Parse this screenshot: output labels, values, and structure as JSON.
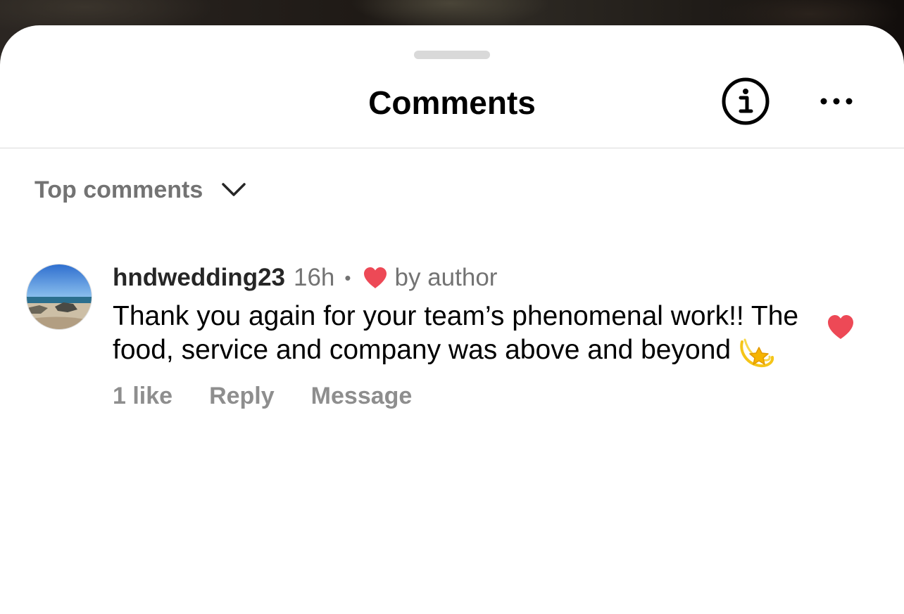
{
  "header": {
    "title": "Comments",
    "info_icon": "info-circle-icon",
    "more_icon": "ellipsis-icon"
  },
  "sort": {
    "label": "Top comments",
    "icon": "chevron-down-icon"
  },
  "comment": {
    "username": "hndwedding23",
    "time": "16h",
    "separator": "•",
    "author_badge_icon": "heart-icon",
    "author_badge_text": "by author",
    "text": "Thank you again for your team’s phenomenal work!! The food, service and company was above and beyond",
    "emoji": "dizzy-sparkle-emoji",
    "likes": "1 like",
    "reply_label": "Reply",
    "message_label": "Message",
    "liked": true
  },
  "colors": {
    "heart": "#ED4956",
    "secondary_text": "#737373",
    "action_text": "#8E8E8E",
    "divider": "#DBDBDB",
    "grabber": "#D9D9D9"
  }
}
